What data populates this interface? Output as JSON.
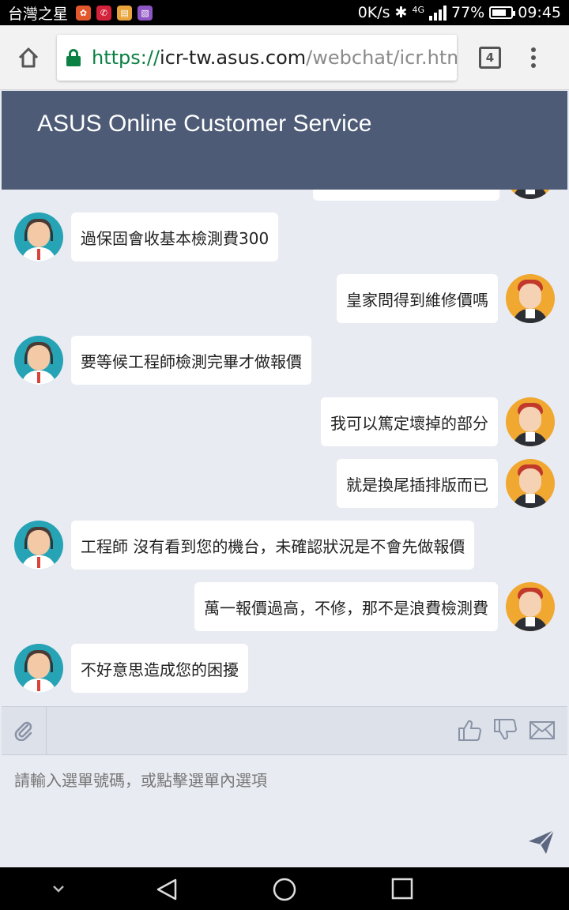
{
  "status_bar": {
    "carrier": "台灣之星",
    "speed": "0K/s",
    "network": "4G",
    "battery": "77%",
    "battery_level": 0.77,
    "time": "09:45",
    "app_icon_colors": [
      "#e2572b",
      "#d3223a",
      "#e8a33a",
      "#8e55c4"
    ]
  },
  "browser": {
    "url_scheme": "https://",
    "url_host": "icr-tw.asus.com",
    "url_path": "/webchat/icr.html",
    "tab_count": "4",
    "home_icon": "home-icon",
    "menu_icon": "more-vert-icon"
  },
  "header": {
    "title": "ASUS Online Customer Service",
    "background": "#4d5b76"
  },
  "chat": {
    "messages": [
      {
        "sender": "agent",
        "text": "過保固會收基本檢測費300"
      },
      {
        "sender": "user",
        "text": "皇家問得到維修價嗎"
      },
      {
        "sender": "agent",
        "text": "要等候工程師檢測完畢才做報價"
      },
      {
        "sender": "user",
        "text": "我可以篤定壞掉的部分"
      },
      {
        "sender": "user",
        "text": "就是換尾插排版而已"
      },
      {
        "sender": "agent",
        "text": "工程師 沒有看到您的機台，未確認狀況是不會先做報價"
      },
      {
        "sender": "user",
        "text": "萬一報價過高，不修，那不是浪費檢測費"
      },
      {
        "sender": "agent",
        "text": "不好意思造成您的困擾"
      }
    ]
  },
  "actions": {
    "icons": [
      "paperclip-icon",
      "thumbs-up-icon",
      "thumbs-down-icon",
      "mail-icon"
    ]
  },
  "input": {
    "placeholder": "請輸入選單號碼，或點擊選單內選項"
  },
  "nav": {
    "icons": [
      "chevron-down-icon",
      "back-icon",
      "home-circle-icon",
      "recents-icon"
    ]
  }
}
